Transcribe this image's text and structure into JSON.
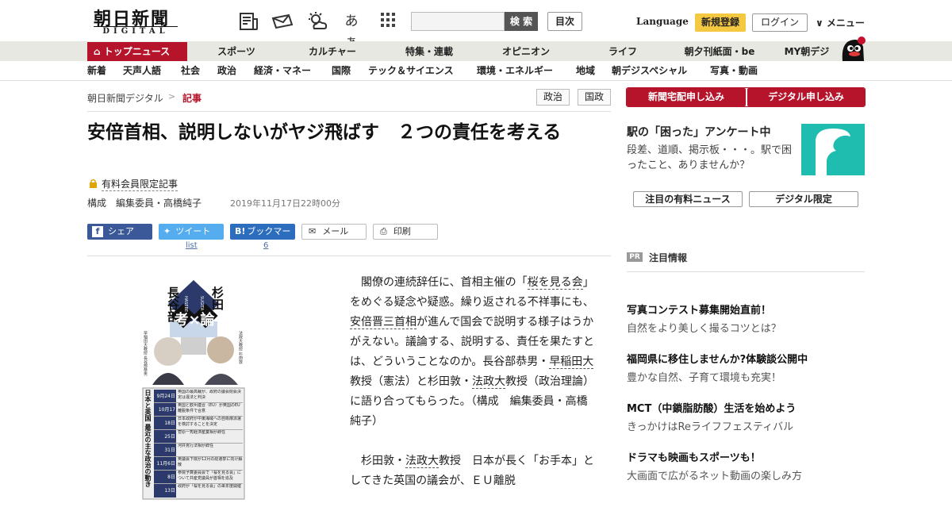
{
  "header": {
    "logo_main": "朝日新聞",
    "logo_sub": "DIGITAL",
    "icons": [
      "newspaper-icon",
      "mail-icon",
      "weather-icon",
      "font-size-icon",
      "grid-menu-icon"
    ],
    "font_size_label": "あぁ",
    "search_placeholder": "",
    "search_label": "検 索",
    "mokuji_label": "目次",
    "language_label": "Language",
    "register_label": "新規登録",
    "login_label": "ログイン",
    "menu_label": "∨ メニュー"
  },
  "nav1": {
    "top_label": "トップニュース",
    "items": [
      "スポーツ",
      "カルチャー",
      "特集・連載",
      "オピニオン",
      "ライフ",
      "朝夕刊紙面・be",
      "MY朝デジ"
    ]
  },
  "nav2": {
    "items": [
      "新着",
      "天声人語",
      "社会",
      "政治",
      "経済・マネー",
      "国際",
      "テック＆サイエンス",
      "環境・エネルギー",
      "地域",
      "朝デジスペシャル",
      "写真・動画"
    ]
  },
  "breadcrumb": {
    "home": "朝日新聞デジタル",
    "sep": ">",
    "current": "記事"
  },
  "tags": [
    "政治",
    "国政"
  ],
  "article": {
    "headline": "安倍首相、説明しないがヤジ飛ばす　２つの責任を考える",
    "paid_label": "有料会員限定記事",
    "byline": "構成　編集委員・高橋純子",
    "date": "2019年11月17日22時00分",
    "share": {
      "facebook": "シェア",
      "twitter": "ツイート",
      "hatena": "ブックマーク",
      "mail": "メール",
      "print": "印刷",
      "twitter_count": "list",
      "hatena_count": "6"
    },
    "p1_a": "閣僚の連続辞任に、首相主催の「",
    "p1_link1": "桜を見る会",
    "p1_b": "」をめぐる疑念や疑惑。繰り返される不祥事にも、",
    "p1_link2": "安倍晋三首相",
    "p1_c": "が進んで国会で説明する様子はうかがえない。議論する、説明する、責任を果たすとは、どういうことなのか。長谷部恭男・",
    "p1_link3": "早稲田大",
    "p1_d": "教授（憲法）と杉田敦・",
    "p1_link4": "法政大",
    "p1_e": "教授（政治理論）に語り合ってもらった。（構成　編集委員・高橋純子）",
    "p2_a": "杉田敦・",
    "p2_link": "法政大",
    "p2_b": "教授　日本が長く「お手本」としてきた英国の議会が、ＥＵ離脱"
  },
  "illustration": {
    "names_left": "長谷部",
    "names_right": "杉田",
    "sub_left": "HASEBE",
    "sub_right": "SUGITA",
    "title": "考×論",
    "person_left_caption": "早稲田大教授 長谷部恭男",
    "person_right_caption": "法政大教授 杉田敦",
    "timeline_title": "日本と英国 最近の主な政治の動き",
    "timeline": [
      {
        "date": "9月24日",
        "text": "英国の最高裁が、政府の議会閉会決定は違法と判決"
      },
      {
        "date": "10月17日",
        "text": "英国と欧州連合（EU）が英国のEU離脱条件で合意"
      },
      {
        "date": "18日",
        "text": "日本政府が中東海域への自衛隊派遣を検討することを決定"
      },
      {
        "date": "25日",
        "text": "菅原一秀経済産業相が辞任"
      },
      {
        "date": "31日",
        "text": "河井克行法相が辞任"
      },
      {
        "date": "11月6日",
        "text": "英議会下院が12月の総選挙に向け解散"
      },
      {
        "date": "8日",
        "text": "参院予算委員会で「桜を見る会」について共産党議員が首相を追及"
      },
      {
        "date": "13日",
        "text": "政府が「桜を見る会」の来年度開催"
      }
    ]
  },
  "sidebar": {
    "btn_home": "新聞宅配申し込み",
    "btn_digital": "デジタル申し込み",
    "ad_title": "駅の「困った」アンケート中",
    "ad_text": "段差、道順、掲示板・・・。駅で困ったこと、ありませんか？",
    "tab1": "注目の有料ニュース",
    "tab2": "デジタル限定",
    "pr_badge": "PR",
    "pr_title": "注目情報",
    "pr_items": [
      {
        "title": "写真コンテスト募集開始直前！",
        "sub": "自然をより美しく撮るコツとは？"
      },
      {
        "title": "福岡県に移住しませんか?体験談公開中",
        "sub": "豊かな自然、子育て環境も充実！"
      },
      {
        "title": "MCT（中鎖脂肪酸）生活を始めよう",
        "sub": "きっかけはReライフフェスティバル"
      },
      {
        "title": "ドラマも映画もスポーツも！",
        "sub": "大画面で広がるネット動画の楽しみ方"
      }
    ]
  }
}
